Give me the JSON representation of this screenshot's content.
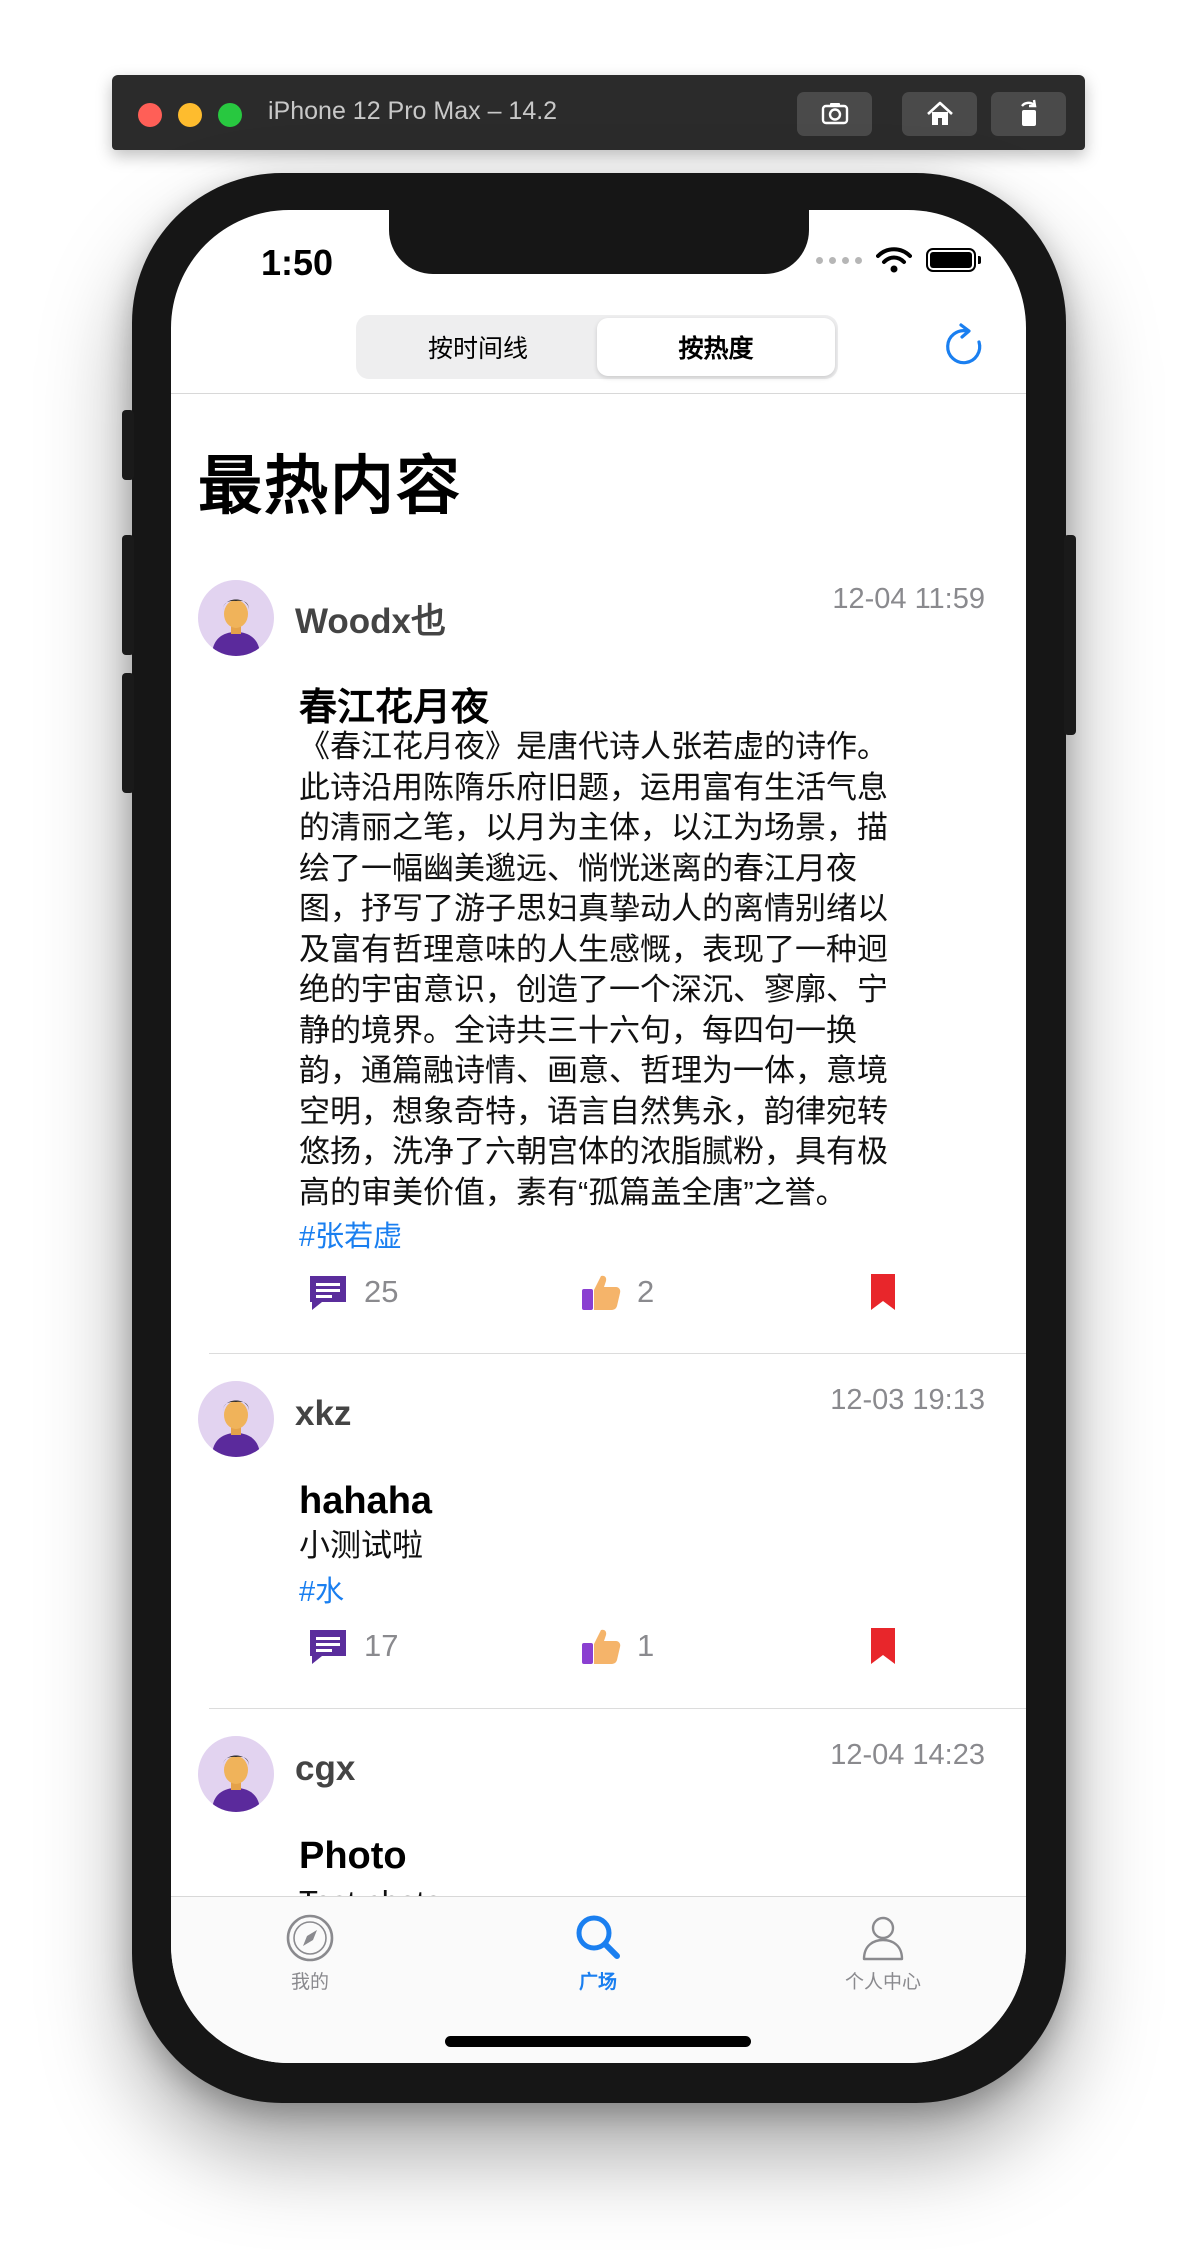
{
  "simulator": {
    "title": "iPhone 12 Pro Max – 14.2"
  },
  "status_bar": {
    "time": "1:50"
  },
  "navbar": {
    "segments": [
      {
        "label": "按时间线",
        "selected": false
      },
      {
        "label": "按热度",
        "selected": true
      }
    ]
  },
  "page": {
    "title": "最热内容"
  },
  "posts": [
    {
      "username": "Woodx也",
      "time": "12-04 11:59",
      "title": "春江花月夜",
      "body_lines": [
        "《春江花月夜》是唐代诗人张若虚的诗作。",
        "此诗沿用陈隋乐府旧题，运用富有生活气息",
        "的清丽之笔，以月为主体，以江为场景，描",
        "绘了一幅幽美邈远、惝恍迷离的春江月夜",
        "图，抒写了游子思妇真挚动人的离情别绪以",
        "及富有哲理意味的人生感慨，表现了一种迥",
        "绝的宇宙意识，创造了一个深沉、寥廓、宁",
        "静的境界。全诗共三十六句，每四句一换",
        "韵，通篇融诗情、画意、哲理为一体，意境",
        "空明，想象奇特，语言自然隽永，韵律宛转",
        "悠扬，洗净了六朝宫体的浓脂腻粉，具有极",
        "高的审美价值，素有“孤篇盖全唐”之誉。"
      ],
      "tag": "#张若虚",
      "comments": "25",
      "likes": "2"
    },
    {
      "username": "xkz",
      "time": "12-03 19:13",
      "title": "hahaha",
      "body_lines": [
        "小测试啦"
      ],
      "tag": "#水",
      "comments": "17",
      "likes": "1"
    },
    {
      "username": "cgx",
      "time": "12-04 14:23",
      "title": "Photo",
      "body_lines": [
        "Test photo"
      ]
    }
  ],
  "tabbar": {
    "tabs": [
      {
        "label": "我的",
        "icon": "compass-icon",
        "active": false
      },
      {
        "label": "广场",
        "icon": "search-icon",
        "active": true
      },
      {
        "label": "个人中心",
        "icon": "person-icon",
        "active": false
      }
    ]
  },
  "colors": {
    "accent": "#1a7ff0",
    "comment_icon": "#5a2d9c",
    "bookmark": "#e8262b",
    "avatar_bg": "#e2d3f0"
  }
}
